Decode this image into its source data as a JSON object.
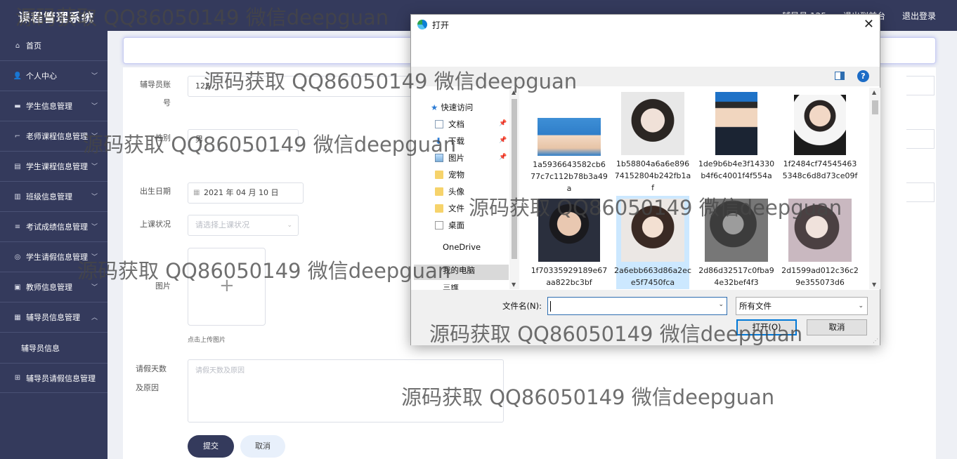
{
  "header": {
    "title": "课程管理系统",
    "links": [
      "辅导员 125",
      "退出到前台",
      "退出登录"
    ]
  },
  "sidebar": {
    "items": [
      {
        "label": "首页",
        "icon": "home-icon",
        "glyph": "⌂",
        "expandable": false
      },
      {
        "label": "个人中心",
        "icon": "user-icon",
        "glyph": "👤",
        "expandable": true
      },
      {
        "label": "学生信息管理",
        "icon": "book-icon",
        "glyph": "▬",
        "expandable": true
      },
      {
        "label": "老师课程信息管理",
        "icon": "crop-icon",
        "glyph": "⌐",
        "expandable": true
      },
      {
        "label": "学生课程信息管理",
        "icon": "briefcase-icon",
        "glyph": "▤",
        "expandable": true
      },
      {
        "label": "班级信息管理",
        "icon": "chart-icon",
        "glyph": "▥",
        "expandable": true
      },
      {
        "label": "考试成绩信息管理",
        "icon": "list-icon",
        "glyph": "≡",
        "expandable": true
      },
      {
        "label": "学生请假信息管理",
        "icon": "circle-icon",
        "glyph": "◎",
        "expandable": true
      },
      {
        "label": "教师信息管理",
        "icon": "window-icon",
        "glyph": "▣",
        "expandable": true
      },
      {
        "label": "辅导员信息管理",
        "icon": "doc-icon",
        "glyph": "▦",
        "expandable": true,
        "expanded": true
      }
    ],
    "subitem": "辅导员信息",
    "last_item": {
      "label": "辅导员请假信息管理",
      "icon": "grid-icon",
      "glyph": "⊞"
    }
  },
  "form": {
    "account_label": "辅导员账号",
    "account_value": "125",
    "gender_label": "性别",
    "gender_value": "男",
    "birth_label": "出生日期",
    "birth_value": "2021 年 04 月 10 日",
    "status_label": "上课状况",
    "status_placeholder": "请选择上课状况",
    "photo_label": "图片",
    "upload_hint": "点击上传图片",
    "leave_label": "请假天数及原因",
    "leave_placeholder": "请假天数及原因",
    "submit": "提交",
    "cancel": "取消"
  },
  "dialog": {
    "title": "打开",
    "nav": {
      "quick_access": "快速访问",
      "items": [
        "文档",
        "下载",
        "图片",
        "宠物",
        "头像",
        "文件",
        "桌面"
      ],
      "onedrive": "OneDrive",
      "this_pc": "我的电脑",
      "partial": "三维"
    },
    "files": [
      "1a5936643582cb677c7c112b78b3a49a",
      "1b58804a6a6e89674152804b242fb1af",
      "1de9b6b4e3f14330b4f6c4001f4f554a",
      "1f2484cf745454635348c6d8d73ce09f",
      "1f70335929189e67aa822bc3bf",
      "2a6ebb663d86a2ece5f7450fca",
      "2d86d32517c0fba94e32bef4f3",
      "2d1599ad012c36c29e355073d6"
    ],
    "filename_label": "文件名(N):",
    "filename_value": "",
    "filetype": "所有文件",
    "open_button": "打开(O)",
    "cancel_button": "取消"
  },
  "watermarks": [
    "源码获取 QQ86050149 微信deepguan"
  ]
}
